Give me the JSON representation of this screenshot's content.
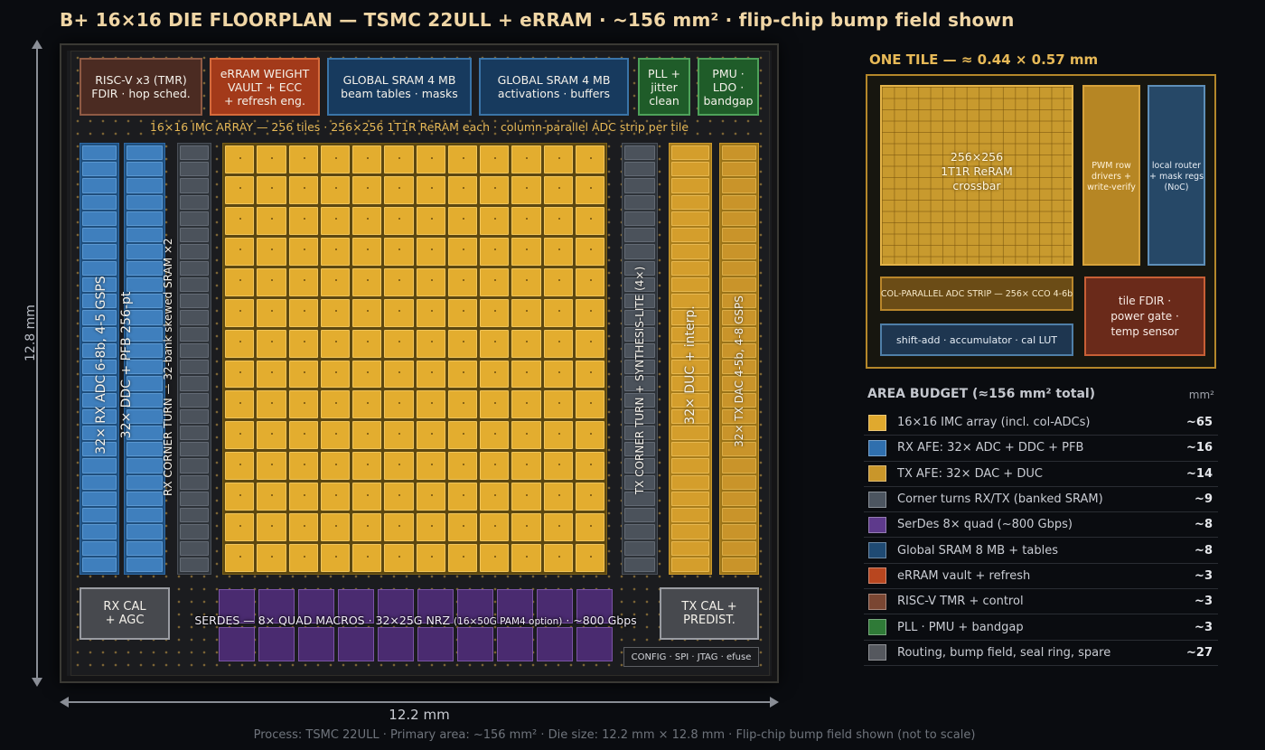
{
  "title": "B+ 16×16 DIE FLOORPLAN — TSMC 22ULL + eRRAM · ~156 mm² · flip-chip bump field shown",
  "dimensions": {
    "height": "12.8 mm",
    "width": "12.2 mm"
  },
  "die": {
    "top_blocks": {
      "riscv": [
        "RISC-V x3 (TMR)",
        "FDIR · hop sched."
      ],
      "erram": [
        "eRRAM WEIGHT",
        "VAULT + ECC",
        "+ refresh eng."
      ],
      "sram1": [
        "GLOBAL SRAM 4 MB",
        "beam tables · masks"
      ],
      "sram2": [
        "GLOBAL SRAM 4 MB",
        "activations · buffers"
      ],
      "pll": [
        "PLL +",
        "jitter",
        "clean"
      ],
      "pmu": [
        "PMU ·",
        "LDO ·",
        "bandgap"
      ]
    },
    "imc_caption": "16×16 IMC ARRAY — 256 tiles  ·  256×256 1T1R ReRAM each  ·  column-parallel ADC strip per tile",
    "strips": {
      "rx_adc": "32× RX ADC 6-8b, 4-5 GSPS",
      "rx_ddc": "32× DDC + PFB 256-pt",
      "rx_corner": "RX CORNER TURN — 32-bank skewed SRAM ×2",
      "tx_corner": "TX CORNER TURN + SYNTHESIS-LITE (4×)",
      "tx_duc": "32× DUC + interp.",
      "tx_dac": "32× TX DAC 4-5b, 4-8 GSPS"
    },
    "rx_cal": [
      "RX CAL",
      "+ AGC"
    ],
    "tx_cal": [
      "TX CAL +",
      "PREDIST."
    ],
    "serdes_label": "SERDES — 8× QUAD MACROS · 32×25G NRZ",
    "serdes_option": "(16×50G PAM4 option)",
    "serdes_tail": "· ~800 Gbps",
    "config": "CONFIG · SPI · JTAG · efuse"
  },
  "tile": {
    "title": "ONE TILE — ≈ 0.44 × 0.57 mm",
    "crossbar": [
      "256×256",
      "1T1R ReRAM",
      "crossbar"
    ],
    "pwm": [
      "PWM row",
      "drivers +",
      "write-verify"
    ],
    "router": [
      "local router",
      "+ mask regs",
      "(NoC)"
    ],
    "adc_strip": "COL-PARALLEL ADC STRIP — 256× CCO 4-6b",
    "shift_add": "shift-add · accumulator · cal LUT",
    "fdir": [
      "tile FDIR ·",
      "power gate ·",
      "temp sensor"
    ]
  },
  "budget": {
    "title": "AREA BUDGET (≈156 mm² total)",
    "unit": "mm²",
    "rows": [
      {
        "label": "16×16 IMC array (incl. col-ADCs)",
        "value": "~65",
        "color": "#e0a92e"
      },
      {
        "label": "RX AFE: 32× ADC + DDC + PFB",
        "value": "~16",
        "color": "#2f6fae"
      },
      {
        "label": "TX AFE: 32× DAC + DUC",
        "value": "~14",
        "color": "#c9962a"
      },
      {
        "label": "Corner turns RX/TX (banked SRAM)",
        "value": "~9",
        "color": "#4c5560"
      },
      {
        "label": "SerDes 8× quad (~800 Gbps)",
        "value": "~8",
        "color": "#5e3a8c"
      },
      {
        "label": "Global SRAM 8 MB + tables",
        "value": "~8",
        "color": "#1f4a73"
      },
      {
        "label": "eRRAM vault + refresh",
        "value": "~3",
        "color": "#b8461f"
      },
      {
        "label": "RISC-V TMR + control",
        "value": "~3",
        "color": "#7a4632"
      },
      {
        "label": "PLL · PMU + bandgap",
        "value": "~3",
        "color": "#2f7a37"
      },
      {
        "label": "Routing, bump field, seal ring, spare",
        "value": "~27",
        "color": "#55585e"
      }
    ]
  },
  "footer": "Process: TSMC 22ULL   ·   Primary area: ~156 mm²   ·   Die size: 12.2 mm × 12.8 mm   ·   Flip-chip bump field shown (not to scale)"
}
